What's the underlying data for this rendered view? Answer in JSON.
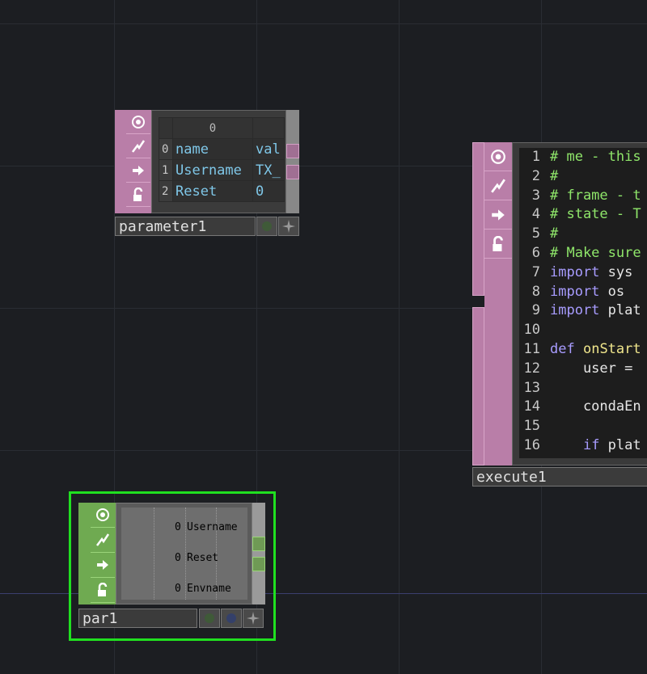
{
  "parameter1": {
    "name": "parameter1",
    "column_header": "0",
    "rows": [
      {
        "index": "0",
        "col0": "name",
        "col1": "val"
      },
      {
        "index": "1",
        "col0": "Username",
        "col1": "TX_"
      },
      {
        "index": "2",
        "col0": "Reset",
        "col1": "0"
      }
    ]
  },
  "execute1": {
    "name": "execute1",
    "lines": [
      {
        "n": "1",
        "tokens": [
          {
            "t": "# me - this",
            "c": "comment"
          }
        ]
      },
      {
        "n": "2",
        "tokens": [
          {
            "t": "#",
            "c": "comment"
          }
        ]
      },
      {
        "n": "3",
        "tokens": [
          {
            "t": "# frame - t",
            "c": "comment"
          }
        ]
      },
      {
        "n": "4",
        "tokens": [
          {
            "t": "# state - T",
            "c": "comment"
          }
        ]
      },
      {
        "n": "5",
        "tokens": [
          {
            "t": "#",
            "c": "comment"
          }
        ]
      },
      {
        "n": "6",
        "tokens": [
          {
            "t": "# Make sure",
            "c": "comment"
          }
        ]
      },
      {
        "n": "7",
        "tokens": [
          {
            "t": "import",
            "c": "kw"
          },
          {
            "t": " sys",
            "c": "txt"
          }
        ]
      },
      {
        "n": "8",
        "tokens": [
          {
            "t": "import",
            "c": "kw"
          },
          {
            "t": " os",
            "c": "txt"
          }
        ]
      },
      {
        "n": "9",
        "tokens": [
          {
            "t": "import",
            "c": "kw"
          },
          {
            "t": " plat",
            "c": "txt"
          }
        ]
      },
      {
        "n": "10",
        "tokens": []
      },
      {
        "n": "11",
        "tokens": [
          {
            "t": "def",
            "c": "kw"
          },
          {
            "t": " ",
            "c": "txt"
          },
          {
            "t": "onStart",
            "c": "fn"
          }
        ]
      },
      {
        "n": "12",
        "tokens": [
          {
            "t": "    user = ",
            "c": "txt"
          }
        ]
      },
      {
        "n": "13",
        "tokens": []
      },
      {
        "n": "14",
        "tokens": [
          {
            "t": "    condaEn",
            "c": "txt"
          }
        ]
      },
      {
        "n": "15",
        "tokens": []
      },
      {
        "n": "16",
        "tokens": [
          {
            "t": "    ",
            "c": "txt"
          },
          {
            "t": "if",
            "c": "kw"
          },
          {
            "t": " plat",
            "c": "txt"
          }
        ]
      }
    ]
  },
  "par1": {
    "name": "par1",
    "rows": [
      {
        "value": "0",
        "label": "Username"
      },
      {
        "value": "0",
        "label": "Reset"
      },
      {
        "value": "0",
        "label": "Envname"
      }
    ]
  },
  "icons": {
    "viewer": "target-icon",
    "cook": "lightning-icon",
    "export": "arrow-right-icon",
    "lock": "lock-icon",
    "display_flag": "circle-flag-icon",
    "render_flag": "circle-flag-icon",
    "bypass_flag": "star-icon"
  },
  "colors": {
    "dat_family": "#b97ea8",
    "chop_family": "#6faa51",
    "selection": "#20e020",
    "background": "#1c1e22"
  }
}
